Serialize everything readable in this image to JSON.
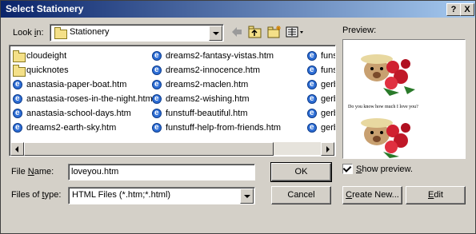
{
  "window": {
    "title": "Select Stationery",
    "help_btn": "?",
    "close_btn": "X"
  },
  "lookin": {
    "label_pre": "Look ",
    "label_u": "i",
    "label_post": "n:",
    "value": "Stationery"
  },
  "files": [
    {
      "name": "cloudeight",
      "type": "folder"
    },
    {
      "name": "quicknotes",
      "type": "folder"
    },
    {
      "name": "anastasia-paper-boat.htm",
      "type": "htm"
    },
    {
      "name": "anastasia-roses-in-the-night.htm",
      "type": "htm"
    },
    {
      "name": "anastasia-school-days.htm",
      "type": "htm"
    },
    {
      "name": "dreams2-earth-sky.htm",
      "type": "htm"
    },
    {
      "name": "dreams2-fantasy-vistas.htm",
      "type": "htm"
    },
    {
      "name": "dreams2-innocence.htm",
      "type": "htm"
    },
    {
      "name": "dreams2-maclen.htm",
      "type": "htm"
    },
    {
      "name": "dreams2-wishing.htm",
      "type": "htm"
    },
    {
      "name": "funstuff-beautiful.htm",
      "type": "htm"
    },
    {
      "name": "funstuff-help-from-friends.htm",
      "type": "htm"
    },
    {
      "name": "funstuff",
      "type": "htm"
    },
    {
      "name": "funstuff",
      "type": "htm"
    },
    {
      "name": "gerbert",
      "type": "htm"
    },
    {
      "name": "gerbert",
      "type": "htm"
    },
    {
      "name": "gerbert",
      "type": "htm"
    },
    {
      "name": "gerbert",
      "type": "htm"
    }
  ],
  "filename": {
    "label_u": "N",
    "label_pre": "File ",
    "label_post": "ame:",
    "value": "loveyou.htm"
  },
  "filetype": {
    "label_pre": "Files of ",
    "label_u": "t",
    "label_post": "ype:",
    "value": "HTML Files (*.htm;*.html)"
  },
  "buttons": {
    "ok": "OK",
    "cancel": "Cancel",
    "create_new_u": "C",
    "create_new_rest": "reate New...",
    "edit_u": "E",
    "edit_rest": "dit"
  },
  "preview": {
    "label": "Preview:",
    "caption": "Do you know how much I love you?",
    "show_u": "S",
    "show_rest": "how preview."
  }
}
